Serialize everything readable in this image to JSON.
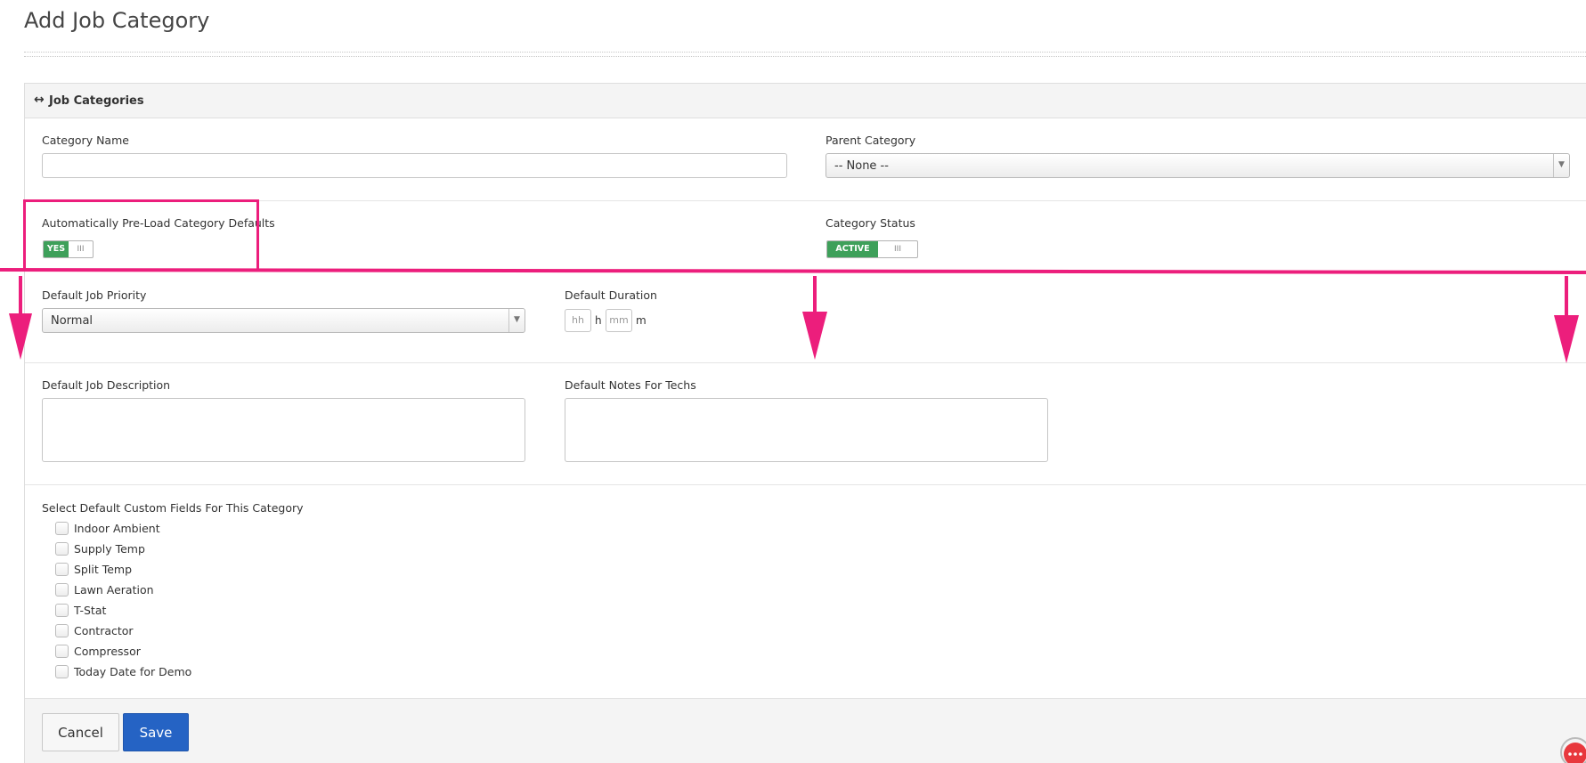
{
  "page": {
    "title": "Add Job Category"
  },
  "panel": {
    "title": "Job Categories",
    "icon": "arrows-horizontal-icon"
  },
  "form": {
    "category_name": {
      "label": "Category Name",
      "value": "",
      "placeholder": ""
    },
    "parent_category": {
      "label": "Parent Category",
      "selected": "-- None --"
    },
    "preload_defaults": {
      "label": "Automatically Pre-Load Category Defaults",
      "state": "YES",
      "grip": "III"
    },
    "category_status": {
      "label": "Category Status",
      "state": "ACTIVE",
      "grip": "III"
    },
    "default_job_priority": {
      "label": "Default Job Priority",
      "selected": "Normal"
    },
    "default_duration": {
      "label": "Default Duration",
      "hours_placeholder": "hh",
      "hours_unit": "h",
      "minutes_placeholder": "mm",
      "minutes_unit": "m"
    },
    "default_job_description": {
      "label": "Default Job Description",
      "value": ""
    },
    "default_notes_for_techs": {
      "label": "Default Notes For Techs",
      "value": ""
    },
    "custom_fields": {
      "label": "Select Default Custom Fields For This Category",
      "items": [
        {
          "label": "Indoor Ambient",
          "checked": false
        },
        {
          "label": "Supply Temp",
          "checked": false
        },
        {
          "label": "Split Temp",
          "checked": false
        },
        {
          "label": "Lawn Aeration",
          "checked": false
        },
        {
          "label": "T-Stat",
          "checked": false
        },
        {
          "label": "Contractor",
          "checked": false
        },
        {
          "label": "Compressor",
          "checked": false
        },
        {
          "label": "Today Date for Demo",
          "checked": false
        }
      ]
    }
  },
  "footer": {
    "cancel_label": "Cancel",
    "save_label": "Save"
  },
  "colors": {
    "toggle_green": "#3ea05a",
    "save_blue": "#2563c4",
    "annotation_pink": "#ec1e7c",
    "chat_red": "#e8383d"
  }
}
